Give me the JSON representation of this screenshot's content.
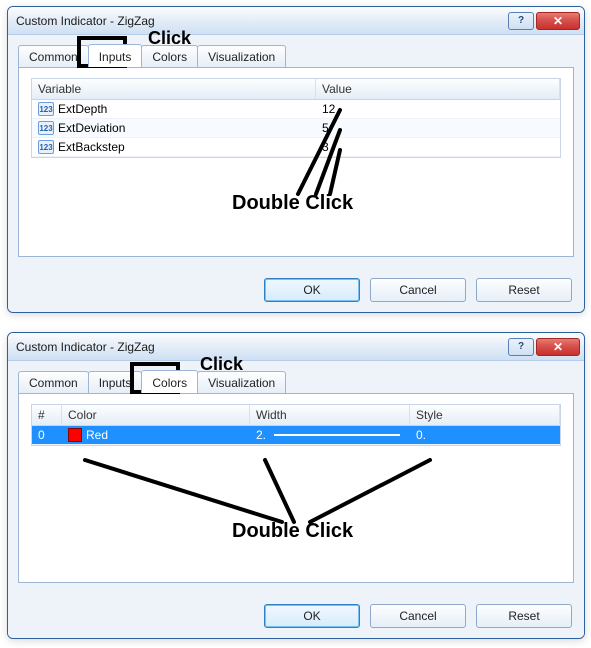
{
  "dialog1": {
    "title": "Custom Indicator - ZigZag",
    "tabs": {
      "common": "Common",
      "inputs": "Inputs",
      "colors": "Colors",
      "viz": "Visualization",
      "active": "inputs"
    },
    "grid": {
      "headers": {
        "variable": "Variable",
        "value": "Value"
      },
      "rows": [
        {
          "icon": "123",
          "name": "ExtDepth",
          "value": "12"
        },
        {
          "icon": "123",
          "name": "ExtDeviation",
          "value": "5"
        },
        {
          "icon": "123",
          "name": "ExtBackstep",
          "value": "3"
        }
      ]
    },
    "buttons": {
      "ok": "OK",
      "cancel": "Cancel",
      "reset": "Reset"
    }
  },
  "dialog2": {
    "title": "Custom Indicator - ZigZag",
    "tabs": {
      "common": "Common",
      "inputs": "Inputs",
      "colors": "Colors",
      "viz": "Visualization",
      "active": "colors"
    },
    "grid": {
      "headers": {
        "index": "#",
        "color": "Color",
        "width": "Width",
        "style": "Style"
      },
      "rows": [
        {
          "index": "0",
          "color_name": "Red",
          "color_hex": "#ff0000",
          "width": "2.",
          "style": "0."
        }
      ]
    },
    "buttons": {
      "ok": "OK",
      "cancel": "Cancel",
      "reset": "Reset"
    }
  },
  "annotations": {
    "click": "Click",
    "double_click": "Double Click"
  },
  "titlebar_buttons": {
    "help": "?",
    "close": "✕"
  }
}
